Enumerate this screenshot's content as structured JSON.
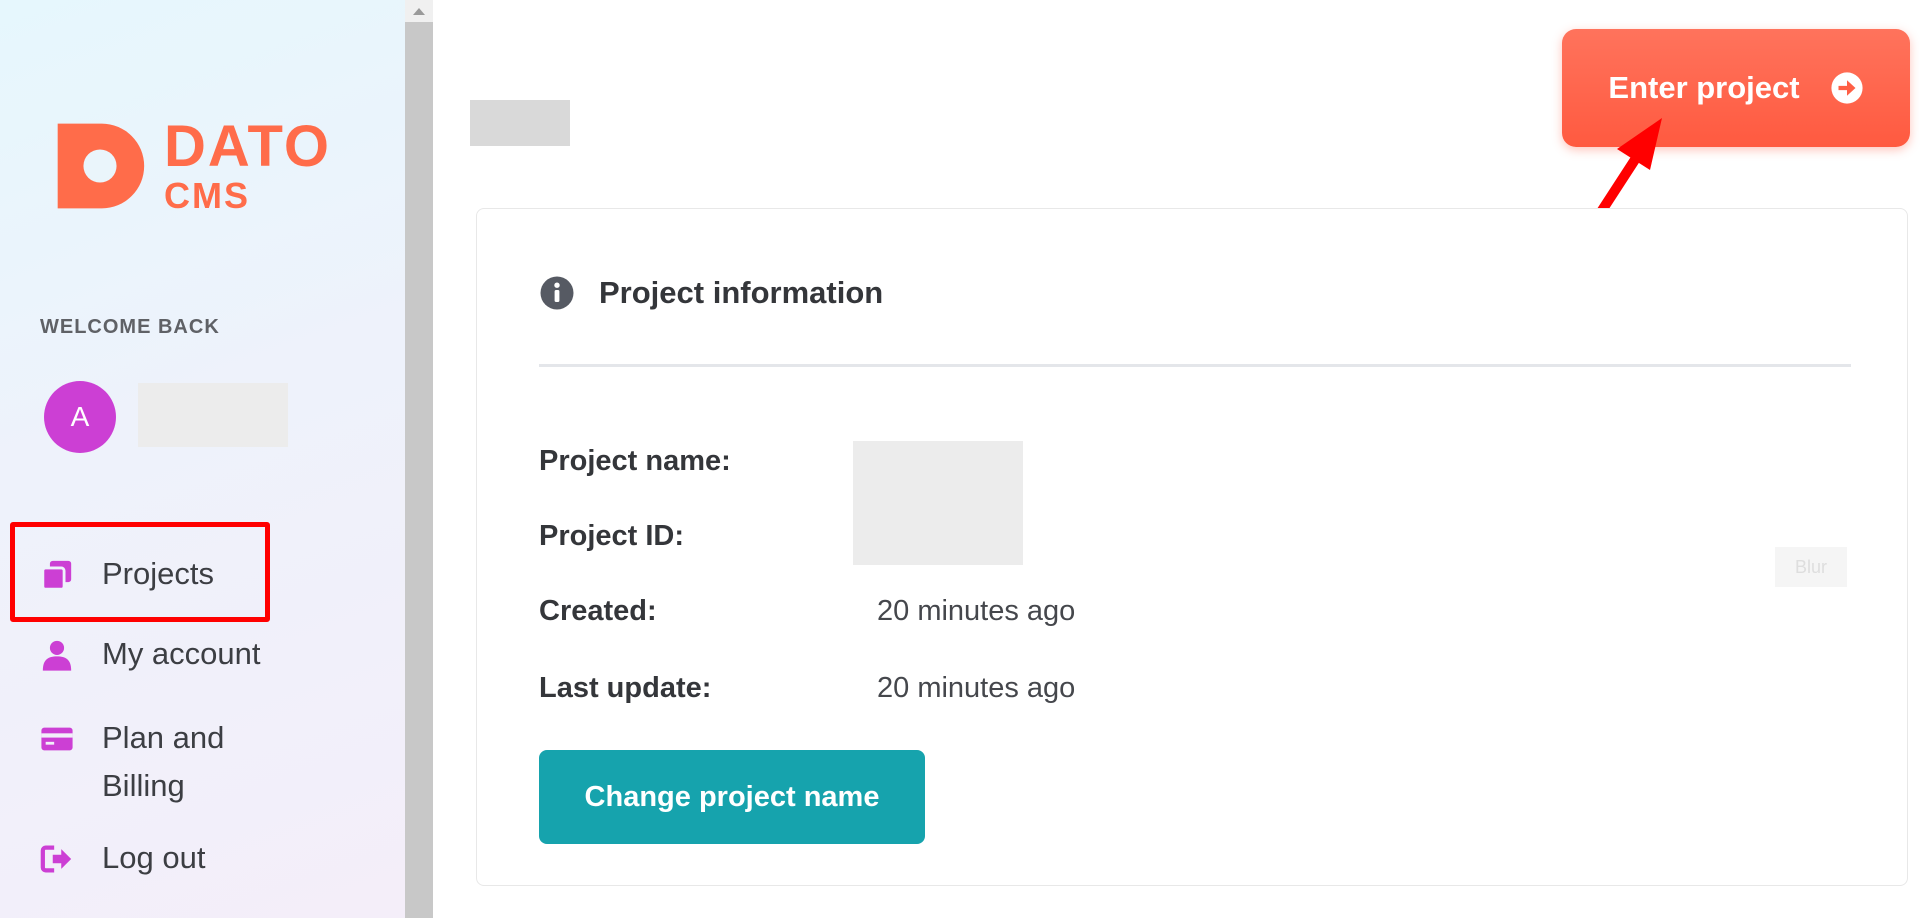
{
  "brand": {
    "line1": "DATO",
    "line2": "CMS",
    "accent_color": "#ff6c4a"
  },
  "sidebar": {
    "welcome_label": "WELCOME BACK",
    "avatar_initial": "A",
    "avatar_color": "#cc3fd4",
    "nav_icon_color": "#cc3fd4",
    "items": [
      {
        "label": "Projects",
        "icon": "projects-icon",
        "highlighted": true
      },
      {
        "label": "My account",
        "icon": "user-icon"
      },
      {
        "label": "Plan and Billing",
        "icon": "credit-card-icon"
      },
      {
        "label": "Log out",
        "icon": "logout-icon"
      }
    ]
  },
  "header": {
    "enter_button_label": "Enter project",
    "enter_button_icon": "arrow-circle-right-icon",
    "enter_button_color": "#ff5a40"
  },
  "card": {
    "title": "Project information",
    "title_icon": "info-icon",
    "fields": [
      {
        "label": "Project name:",
        "value": ""
      },
      {
        "label": "Project ID:",
        "value": ""
      },
      {
        "label": "Created:",
        "value": "20 minutes ago"
      },
      {
        "label": "Last update:",
        "value": "20 minutes ago"
      }
    ],
    "blur_tag": "Blur",
    "change_button_label": "Change project name",
    "change_button_color": "#16a3ad"
  },
  "annotations": {
    "highlight_color": "#ff0000"
  }
}
